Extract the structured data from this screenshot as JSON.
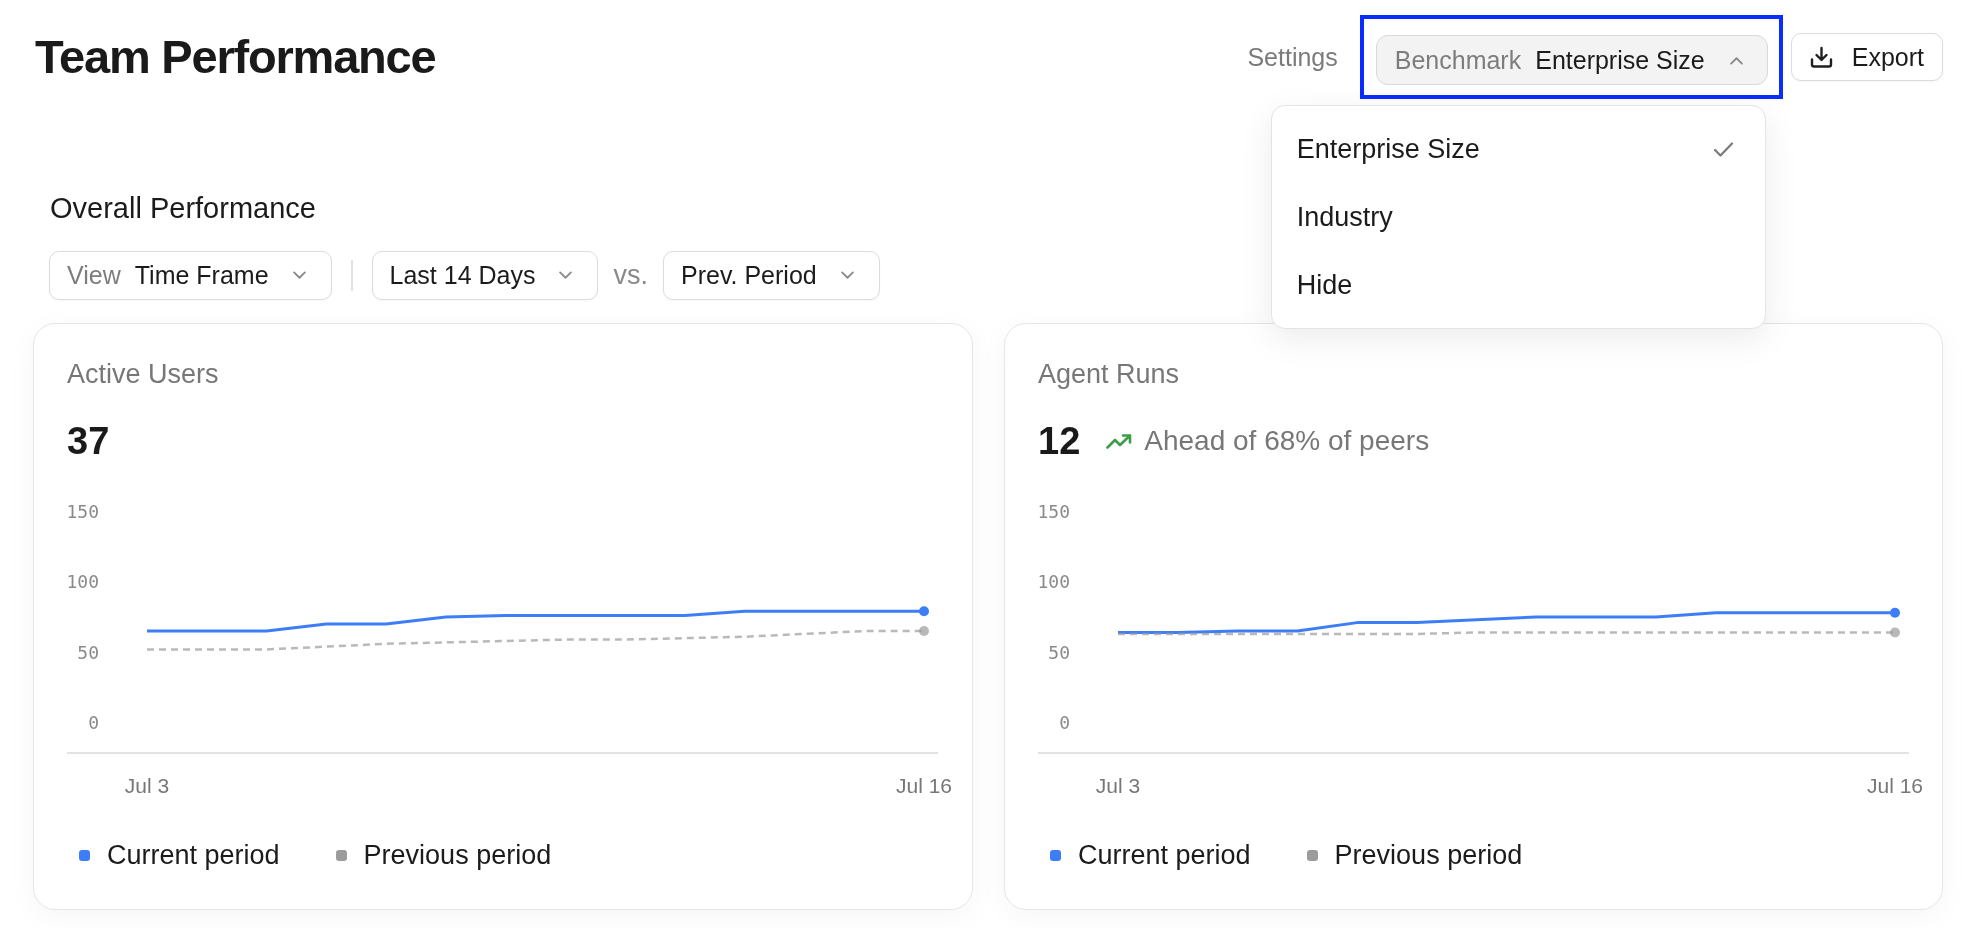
{
  "header": {
    "title": "Team Performance",
    "settings": "Settings",
    "benchmark": {
      "label": "Benchmark",
      "value": "Enterprise Size",
      "expanded": true,
      "highlighted": true,
      "options": [
        {
          "label": "Enterprise Size",
          "selected": true
        },
        {
          "label": "Industry",
          "selected": false
        },
        {
          "label": "Hide",
          "selected": false
        }
      ]
    },
    "export": "Export"
  },
  "section": {
    "title": "Overall Performance",
    "filters": [
      {
        "kind": "select",
        "label": "View",
        "value": "Time Frame"
      },
      {
        "kind": "divider"
      },
      {
        "kind": "select",
        "value": "Last 14 Days"
      },
      {
        "kind": "text",
        "text": "vs."
      },
      {
        "kind": "select",
        "value": "Prev. Period"
      }
    ]
  },
  "cards": [
    {
      "title": "Active Users",
      "value": "37",
      "chart_data": {
        "type": "line",
        "categories": [
          "Jul 3",
          null,
          null,
          null,
          null,
          null,
          null,
          null,
          null,
          null,
          null,
          null,
          null,
          "Jul 16"
        ],
        "ylim": [
          -22,
          150
        ],
        "yticks": [
          0,
          50,
          100,
          150
        ],
        "series": [
          {
            "name": "Current period",
            "color": "#3d7ef7",
            "line_style": "solid",
            "values": [
              65,
              65,
              65,
              70,
              70,
              75,
              76,
              76,
              76,
              76,
              79,
              79,
              79,
              79
            ]
          },
          {
            "name": "Previous period",
            "color": "#9b9b9b",
            "line_style": "dashed",
            "values": [
              52,
              52,
              52,
              54,
              56,
              57,
              58,
              59,
              59,
              60,
              61,
              63,
              65,
              65
            ]
          }
        ]
      }
    },
    {
      "title": "Agent Runs",
      "value": "12",
      "benchmark": {
        "kind": "up",
        "text": "Ahead of 68% of peers"
      },
      "chart_data": {
        "type": "line",
        "categories": [
          "Jul 3",
          null,
          null,
          null,
          null,
          null,
          null,
          null,
          null,
          null,
          null,
          null,
          null,
          "Jul 16"
        ],
        "ylim": [
          -22,
          150
        ],
        "yticks": [
          0,
          50,
          100,
          150
        ],
        "series": [
          {
            "name": "Current period",
            "color": "#3d7ef7",
            "line_style": "solid",
            "values": [
              64,
              64,
              65,
              65,
              71,
              71,
              73,
              75,
              75,
              75,
              78,
              78,
              78,
              78
            ]
          },
          {
            "name": "Previous period",
            "color": "#9b9b9b",
            "line_style": "dashed",
            "values": [
              63,
              63,
              63,
              63,
              63,
              63,
              64,
              64,
              64,
              64,
              64,
              64,
              64,
              64
            ]
          }
        ]
      }
    }
  ]
}
